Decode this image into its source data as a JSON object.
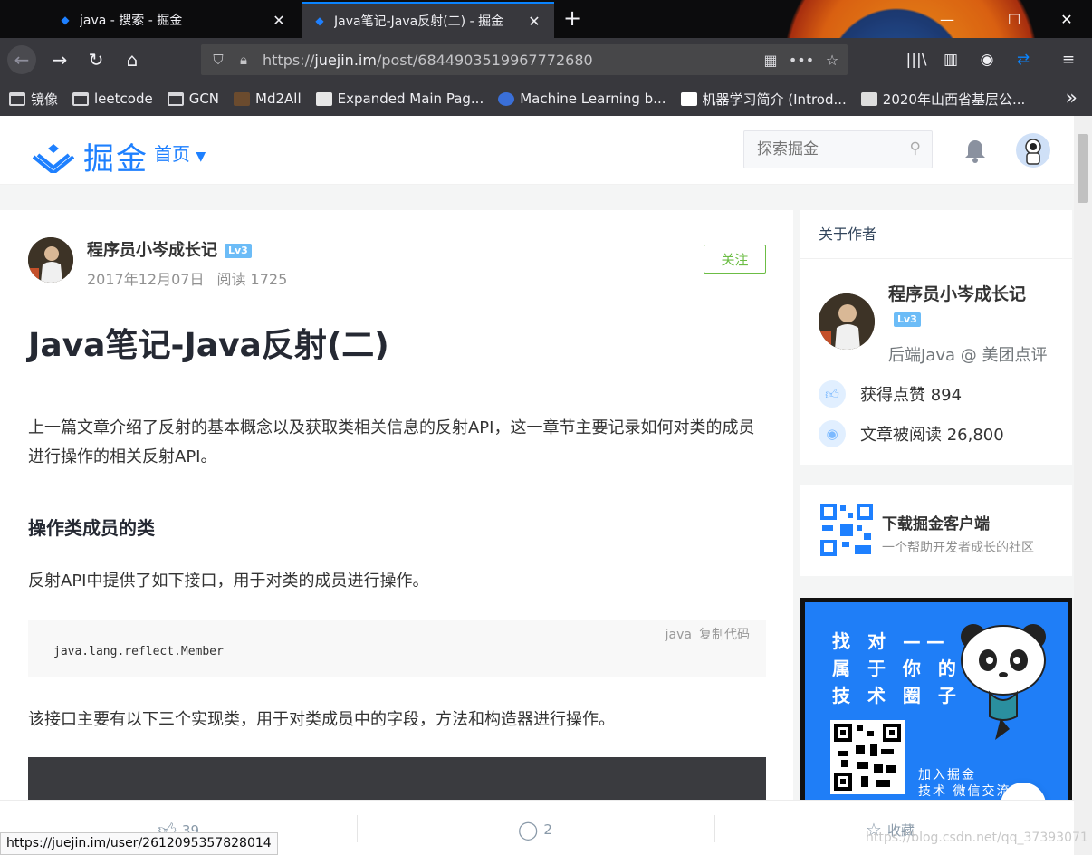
{
  "browser": {
    "tabs": [
      {
        "title": "java - 搜索 - 掘金",
        "active": false
      },
      {
        "title": "Java笔记-Java反射(二) - 掘金",
        "active": true
      }
    ],
    "url_prefix": "https://",
    "url_domain": "juejin.im",
    "url_path": "/post/6844903519967772680",
    "bookmarks": [
      {
        "label": "镜像",
        "icon": "folder-icon"
      },
      {
        "label": "leetcode",
        "icon": "folder-icon"
      },
      {
        "label": "GCN",
        "icon": "folder-icon"
      },
      {
        "label": "Md2All",
        "icon": "favicon"
      },
      {
        "label": "Expanded Main Pag...",
        "icon": "favicon"
      },
      {
        "label": "Machine Learning b...",
        "icon": "favicon"
      },
      {
        "label": "机器学习简介 (Introd...",
        "icon": "favicon"
      },
      {
        "label": "2020年山西省基层公...",
        "icon": "favicon"
      }
    ],
    "status_url": "https://juejin.im/user/2612095357828014"
  },
  "site": {
    "logo_text": "掘金",
    "nav_home": "首页",
    "search_placeholder": "探索掘金"
  },
  "article": {
    "author": "程序员小岑成长记",
    "level": "Lv3",
    "date": "2017年12月07日",
    "reads": "阅读 1725",
    "follow_label": "关注",
    "title": "Java笔记-Java反射(二)",
    "intro": "上一篇文章介绍了反射的基本概念以及获取类相关信息的反射API，这一章节主要记录如何对类的成员进行操作的相关反射API。",
    "section_heading": "操作类成员的类",
    "para2": "反射API中提供了如下接口，用于对类的成员进行操作。",
    "code_lang": "java",
    "code_copy": "复制代码",
    "code": "java.lang.reflect.Member",
    "para3": "该接口主要有以下三个实现类，用于对类成员中的字段，方法和构造器进行操作。"
  },
  "sidebar": {
    "about_header": "关于作者",
    "author": "程序员小岑成长记",
    "level": "Lv3",
    "job": "后端Java @ 美团点评",
    "likes": "获得点赞 894",
    "reads": "文章被阅读 26,800",
    "download_title": "下载掘金客户端",
    "download_sub": "一个帮助开发者成长的社区",
    "ad_lines": [
      "找 对 ——",
      "属 于 你 的",
      "技 术 圈 子"
    ],
    "ad_join_1": "加入掘金",
    "ad_join_2": "技术 微信交流"
  },
  "bottombar": {
    "likes": "39",
    "comments": "2",
    "collect": "收藏"
  },
  "watermark": "https://blog.csdn.net/qq_37393071",
  "colors": {
    "accent": "#1e80ff",
    "follow": "#6cbd45"
  }
}
